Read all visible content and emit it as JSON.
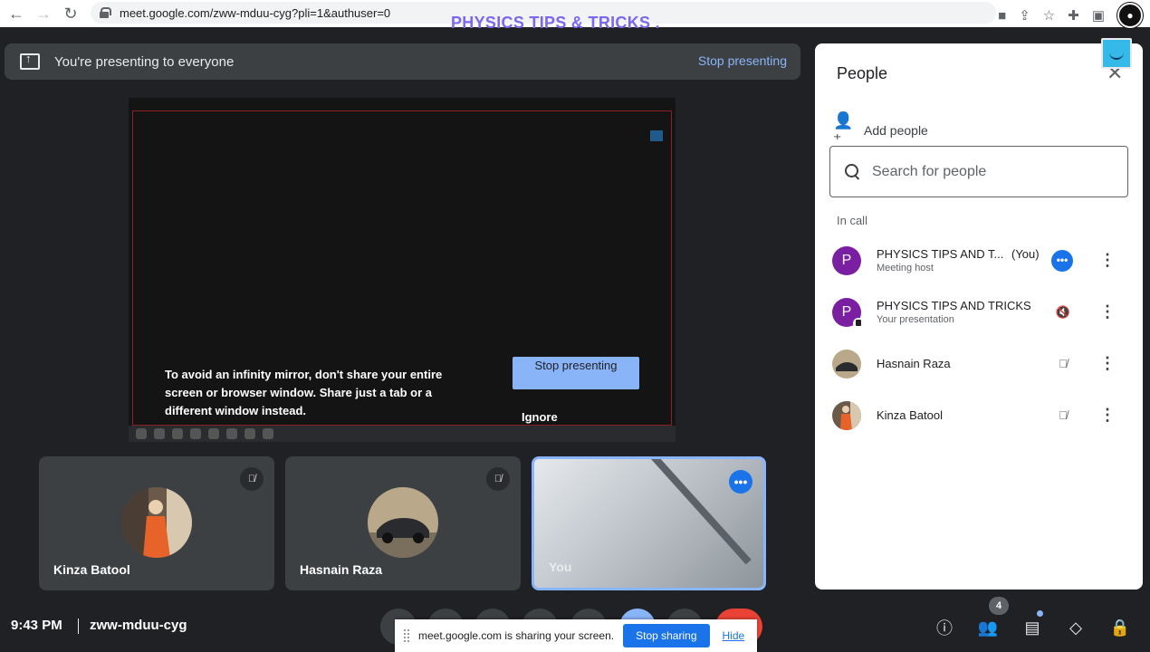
{
  "browser": {
    "url": "meet.google.com/zww-mduu-cyg?pli=1&authuser=0",
    "overlay_title": "PHYSICS TIPS & TRICKS ."
  },
  "banner": {
    "text": "You're presenting to everyone",
    "stop_label": "Stop presenting"
  },
  "shared_screen": {
    "warning": "To avoid an infinity mirror, don't share your entire screen or browser window. Share just a tab or a different window instead.",
    "stop_label": "Stop presenting",
    "ignore_label": "Ignore"
  },
  "tiles": [
    {
      "name": "Kinza Batool"
    },
    {
      "name": "Hasnain Raza"
    },
    {
      "name": "You"
    }
  ],
  "bottom": {
    "time": "9:43 PM",
    "meeting_code": "zww-mduu-cyg",
    "people_count": "4",
    "share_notice": {
      "text": "meet.google.com is sharing your screen.",
      "stop_label": "Stop sharing",
      "hide_label": "Hide"
    }
  },
  "people_panel": {
    "title": "People",
    "add_people": "Add people",
    "search_placeholder": "Search for people",
    "section_label": "In call",
    "participants": [
      {
        "initial": "P",
        "name": "PHYSICS TIPS AND T...",
        "tag": "(You)",
        "subtitle": "Meeting host"
      },
      {
        "initial": "P",
        "name": "PHYSICS TIPS AND TRICKS",
        "subtitle": "Your presentation"
      },
      {
        "name": "Hasnain Raza"
      },
      {
        "name": "Kinza Batool"
      }
    ]
  },
  "colors": {
    "background": "#202124",
    "accent_blue": "#8ab4f8",
    "end_call_red": "#ea4335",
    "avatar_purple": "#7b1fa2"
  }
}
